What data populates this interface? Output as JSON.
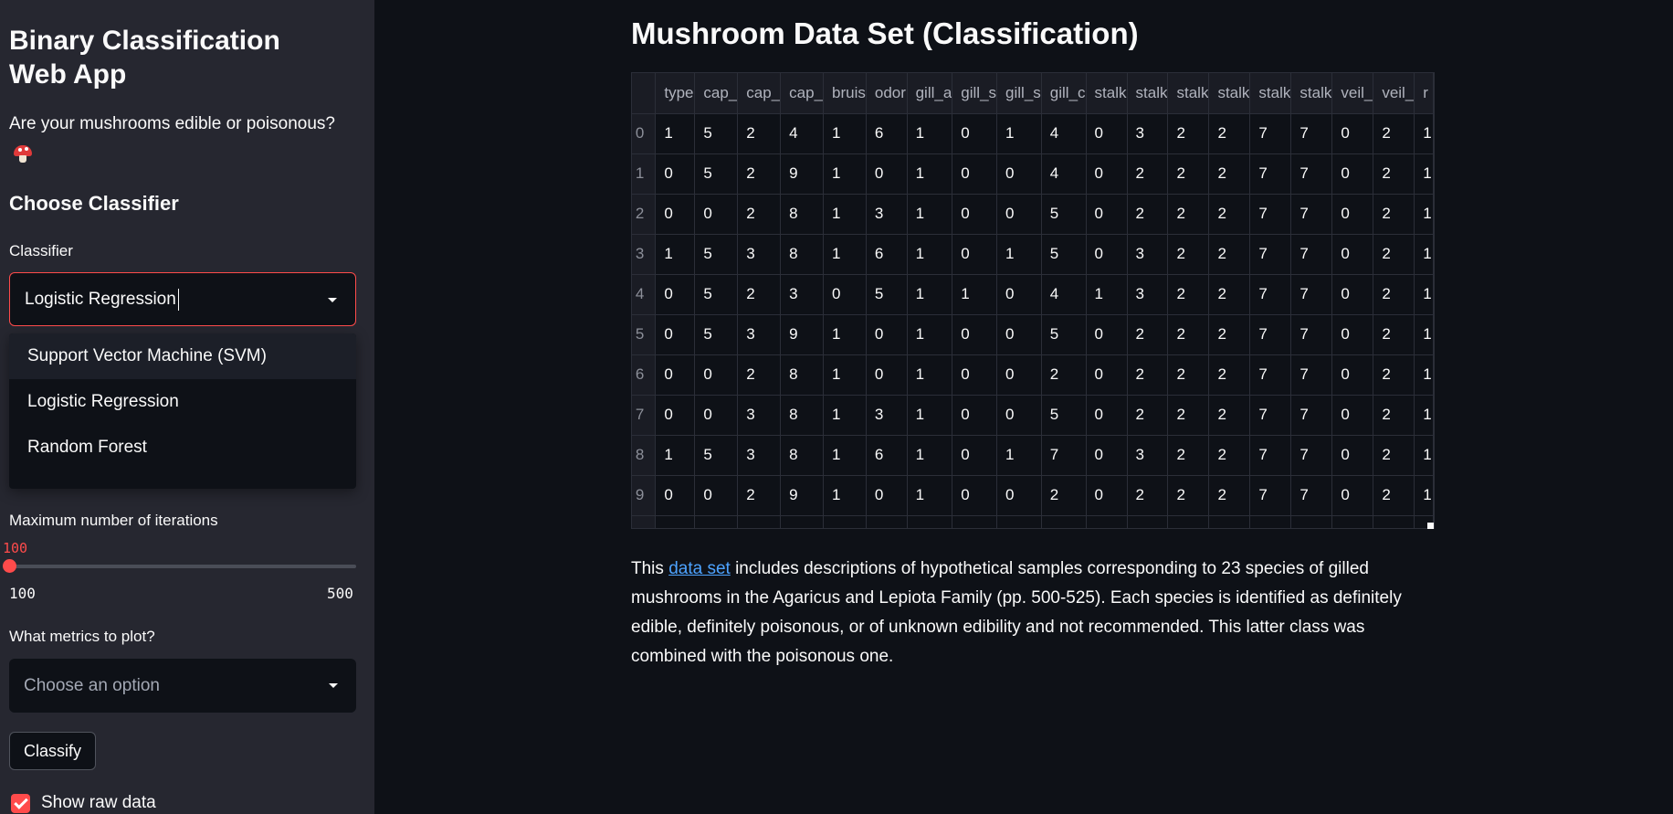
{
  "sidebar": {
    "app_title": "Binary Classification Web App",
    "app_subtitle": "Are your mushrooms edible or poisonous?",
    "section_heading": "Choose Classifier",
    "classifier_label": "Classifier",
    "classifier_value": "Logistic Regression",
    "classifier_options": [
      "Support Vector Machine (SVM)",
      "Logistic Regression",
      "Random Forest"
    ],
    "max_iter_label": "Maximum number of iterations",
    "max_iter_value": "100",
    "max_iter_min": "100",
    "max_iter_max": "500",
    "max_iter_fraction": 0,
    "metrics_label": "What metrics to plot?",
    "metrics_placeholder": "Choose an option",
    "classify_label": "Classify",
    "show_raw_label": "Show raw data",
    "show_raw_checked": true
  },
  "main": {
    "title": "Mushroom Data Set (Classification)",
    "description_prefix": "This ",
    "description_link": "data set",
    "description_suffix": " includes descriptions of hypothetical samples corresponding to 23 species of gilled mushrooms in the Agaricus and Lepiota Family (pp. 500-525). Each species is identified as definitely edible, definitely poisonous, or of unknown edibility and not recommended. This latter class was combined with the poisonous one."
  },
  "table": {
    "columns": [
      "type",
      "cap_",
      "cap_",
      "cap_",
      "bruis",
      "odor",
      "gill_a",
      "gill_s",
      "gill_s",
      "gill_c",
      "stalk",
      "stalk",
      "stalk",
      "stalk",
      "stalk",
      "stalk",
      "veil_",
      "veil_",
      "r"
    ],
    "rows": [
      {
        "index": "0",
        "cells": [
          "1",
          "5",
          "2",
          "4",
          "1",
          "6",
          "1",
          "0",
          "1",
          "4",
          "0",
          "3",
          "2",
          "2",
          "7",
          "7",
          "0",
          "2",
          "1"
        ]
      },
      {
        "index": "1",
        "cells": [
          "0",
          "5",
          "2",
          "9",
          "1",
          "0",
          "1",
          "0",
          "0",
          "4",
          "0",
          "2",
          "2",
          "2",
          "7",
          "7",
          "0",
          "2",
          "1"
        ]
      },
      {
        "index": "2",
        "cells": [
          "0",
          "0",
          "2",
          "8",
          "1",
          "3",
          "1",
          "0",
          "0",
          "5",
          "0",
          "2",
          "2",
          "2",
          "7",
          "7",
          "0",
          "2",
          "1"
        ]
      },
      {
        "index": "3",
        "cells": [
          "1",
          "5",
          "3",
          "8",
          "1",
          "6",
          "1",
          "0",
          "1",
          "5",
          "0",
          "3",
          "2",
          "2",
          "7",
          "7",
          "0",
          "2",
          "1"
        ]
      },
      {
        "index": "4",
        "cells": [
          "0",
          "5",
          "2",
          "3",
          "0",
          "5",
          "1",
          "1",
          "0",
          "4",
          "1",
          "3",
          "2",
          "2",
          "7",
          "7",
          "0",
          "2",
          "1"
        ]
      },
      {
        "index": "5",
        "cells": [
          "0",
          "5",
          "3",
          "9",
          "1",
          "0",
          "1",
          "0",
          "0",
          "5",
          "0",
          "2",
          "2",
          "2",
          "7",
          "7",
          "0",
          "2",
          "1"
        ]
      },
      {
        "index": "6",
        "cells": [
          "0",
          "0",
          "2",
          "8",
          "1",
          "0",
          "1",
          "0",
          "0",
          "2",
          "0",
          "2",
          "2",
          "2",
          "7",
          "7",
          "0",
          "2",
          "1"
        ]
      },
      {
        "index": "7",
        "cells": [
          "0",
          "0",
          "3",
          "8",
          "1",
          "3",
          "1",
          "0",
          "0",
          "5",
          "0",
          "2",
          "2",
          "2",
          "7",
          "7",
          "0",
          "2",
          "1"
        ]
      },
      {
        "index": "8",
        "cells": [
          "1",
          "5",
          "3",
          "8",
          "1",
          "6",
          "1",
          "0",
          "1",
          "7",
          "0",
          "3",
          "2",
          "2",
          "7",
          "7",
          "0",
          "2",
          "1"
        ]
      },
      {
        "index": "9",
        "cells": [
          "0",
          "0",
          "2",
          "9",
          "1",
          "0",
          "1",
          "0",
          "0",
          "2",
          "0",
          "2",
          "2",
          "2",
          "7",
          "7",
          "0",
          "2",
          "1"
        ]
      },
      {
        "index": "",
        "cells": [
          "",
          "",
          "",
          "",
          "",
          "",
          "",
          "",
          "",
          "",
          "",
          "",
          "",
          "",
          "",
          "",
          "",
          "",
          ""
        ]
      }
    ]
  },
  "icons": {
    "mushroom": "mushroom-icon",
    "dropdown": "chevron-down-icon",
    "checkbox": "checkmark-icon"
  },
  "colors": {
    "accent": "#ff4b4b",
    "sidebar_bg": "#262730",
    "main_bg": "#0e1117",
    "link": "#4da3ff"
  }
}
